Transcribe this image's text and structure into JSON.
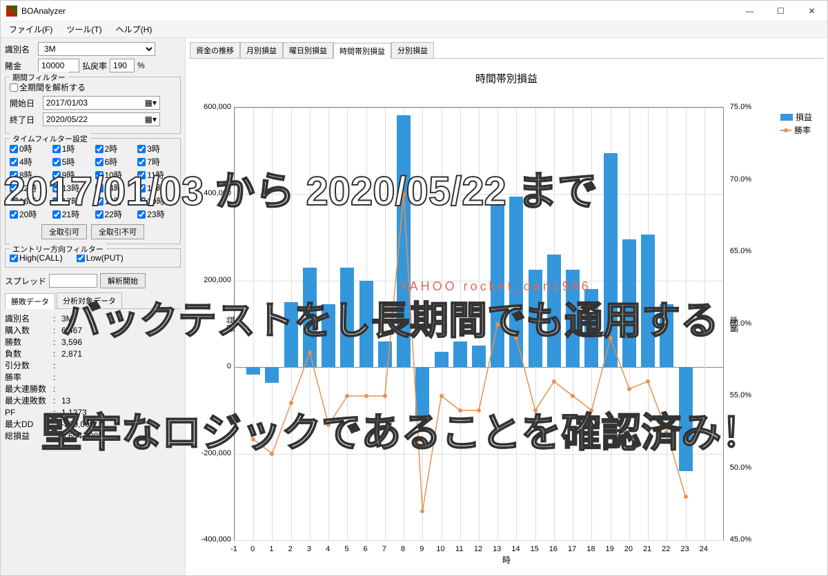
{
  "app": {
    "title": "BOAnalyzer"
  },
  "menu": {
    "file": "ファイル(F)",
    "tool": "ツール(T)",
    "help": "ヘルプ(H)"
  },
  "side": {
    "id_label": "識別名",
    "id_value": "3M",
    "bet_label": "賭金",
    "bet_value": "10000",
    "payout_label": "払戻率",
    "payout_value": "190",
    "payout_unit": "%",
    "period_filter": {
      "title": "期間フィルター",
      "all_label": "全期間を解析する",
      "start_label": "開始日",
      "start_value": "2017/01/03",
      "end_label": "終了日",
      "end_value": "2020/05/22"
    },
    "time_filter": {
      "title": "タイムフィルター設定",
      "hours": [
        "0時",
        "1時",
        "2時",
        "3時",
        "4時",
        "5時",
        "6時",
        "7時",
        "8時",
        "9時",
        "10時",
        "11時",
        "12時",
        "13時",
        "14時",
        "15時",
        "16時",
        "17時",
        "18時",
        "19時",
        "20時",
        "21時",
        "22時",
        "23時"
      ],
      "all_on": "全取引可",
      "all_off": "全取引不可"
    },
    "entry_filter": {
      "title": "エントリー方向フィルター",
      "high": "High(CALL)",
      "low": "Low(PUT)"
    },
    "spread_label": "スプレッド",
    "analyze_btn": "解析開始",
    "data_tabs": [
      "勝敗データ",
      "分析対象データ"
    ],
    "stats": [
      {
        "k": "識別名",
        "v": "3M"
      },
      {
        "k": "購入数",
        "v": "6,467"
      },
      {
        "k": "勝数",
        "v": "3,596"
      },
      {
        "k": "負数",
        "v": "2,871"
      },
      {
        "k": "引分数",
        "v": ""
      },
      {
        "k": "勝率",
        "v": ""
      },
      {
        "k": "最大連勝数",
        "v": ""
      },
      {
        "k": "最大連敗数",
        "v": "13"
      },
      {
        "k": "PF",
        "v": "1.1273"
      },
      {
        "k": "最大DD",
        "v": "-539,000"
      },
      {
        "k": "総損益",
        "v": "3,654,000"
      }
    ]
  },
  "main_tabs": [
    "資金の推移",
    "月別損益",
    "曜日別損益",
    "時間帯別損益",
    "分別損益"
  ],
  "main_active": 3,
  "chart_data": {
    "type": "bar",
    "title": "時間帯別損益",
    "xlabel": "時",
    "ylabel_left": "損益",
    "ylabel_right": "勝率",
    "x_ticks": [
      -1,
      0,
      1,
      2,
      3,
      4,
      5,
      6,
      7,
      8,
      9,
      10,
      11,
      12,
      13,
      14,
      15,
      16,
      17,
      18,
      19,
      20,
      21,
      22,
      23,
      24
    ],
    "y_left_range": [
      -400000,
      600000
    ],
    "y_left_ticks": [
      -400000,
      -200000,
      0,
      200000,
      400000,
      600000
    ],
    "y_right_range": [
      45.0,
      75.0
    ],
    "y_right_ticks": [
      45.0,
      50.0,
      55.0,
      60.0,
      65.0,
      70.0,
      75.0
    ],
    "series": [
      {
        "name": "損益",
        "type": "bar",
        "values": [
          -18000,
          -36000,
          150000,
          230000,
          145000,
          230000,
          200000,
          60000,
          582000,
          -115000,
          35000,
          60000,
          50000,
          385000,
          395000,
          225000,
          260000,
          225000,
          180000,
          495000,
          295000,
          306000,
          145000,
          -240000
        ]
      },
      {
        "name": "勝率",
        "type": "line",
        "values": [
          52.0,
          51.0,
          54.5,
          58.0,
          53.0,
          55.0,
          55.0,
          55.0,
          69.0,
          47.0,
          55.0,
          54.0,
          54.0,
          60.0,
          59.0,
          54.0,
          56.0,
          55.0,
          54.0,
          59.0,
          55.5,
          56.0,
          52.5,
          48.0
        ]
      }
    ],
    "legend": [
      "損益",
      "勝率"
    ]
  },
  "watermark": "YAHOO  rocket_dan1996",
  "overlay": {
    "line1": "2017/01/03 から 2020/05/22 まで",
    "line2": "バックテストをし長期間でも通用する",
    "line3": "堅牢なロジックであることを確認済み！"
  }
}
